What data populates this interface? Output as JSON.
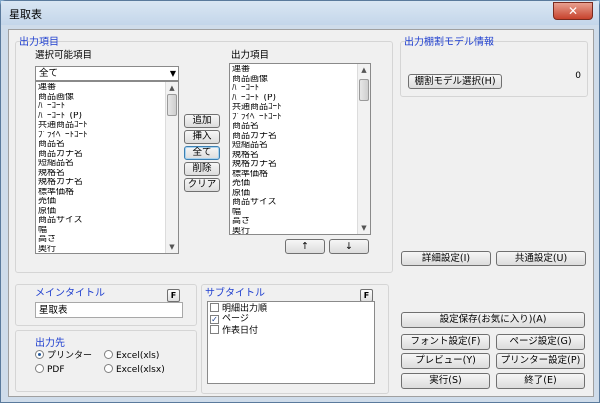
{
  "window": {
    "title": "星取表",
    "close_glyph": "✕"
  },
  "output_items_section": {
    "label": "出力項目",
    "selectable": {
      "label": "選択可能項目",
      "filter_value": "全て",
      "items": [
        "連番",
        "商品画像",
        "ﾊﾞｰｺｰﾄﾞ",
        "ﾊﾞｰｺｰﾄﾞ(P)",
        "共通商品ｺｰﾄﾞ",
        "ﾌﾟﾗｲﾍﾞｰﾄｺｰﾄﾞ",
        "商品名",
        "商品カナ名",
        "短縮品名",
        "規格名",
        "規格カナ名",
        "標準価格",
        "売価",
        "原価",
        "商品サイズ",
        "幅",
        "高さ",
        "奥行"
      ]
    },
    "output": {
      "label": "出力項目",
      "items": [
        "連番",
        "商品画像",
        "ﾊﾞｰｺｰﾄﾞ",
        "ﾊﾞｰｺｰﾄﾞ(P)",
        "共通商品ｺｰﾄﾞ",
        "ﾌﾟﾗｲﾍﾞｰﾄｺｰﾄﾞ",
        "商品名",
        "商品カナ名",
        "短縮品名",
        "規格名",
        "規格カナ名",
        "標準価格",
        "売価",
        "原価",
        "商品サイズ",
        "幅",
        "高さ",
        "奥行"
      ]
    },
    "buttons": {
      "add": "追加",
      "insert": "挿入",
      "all": "全て",
      "delete": "削除",
      "clear": "クリア"
    },
    "move_up": "↑",
    "move_down": "↓"
  },
  "shelf_model": {
    "label": "出力棚割モデル情報",
    "select_button": "棚割モデル選択(H)",
    "count_value": "0"
  },
  "main_title": {
    "label": "メインタイトル",
    "f_button": "F",
    "value": "星取表"
  },
  "sub_title": {
    "label": "サブタイトル",
    "f_button": "F",
    "items": [
      {
        "label": "明細出力順",
        "checked": false
      },
      {
        "label": "ページ",
        "checked": true
      },
      {
        "label": "作表日付",
        "checked": false
      }
    ],
    "check_glyph": "✓"
  },
  "destination": {
    "label": "出力先",
    "options": [
      {
        "label": "プリンター",
        "selected": true
      },
      {
        "label": "Excel(xls)",
        "selected": false
      },
      {
        "label": "PDF",
        "selected": false
      },
      {
        "label": "Excel(xlsx)",
        "selected": false
      }
    ]
  },
  "actions": {
    "detail_settings": "詳細設定(I)",
    "common_settings": "共通設定(U)",
    "save_settings": "設定保存(お気に入り)(A)",
    "font_settings": "フォント設定(F)",
    "page_settings": "ページ設定(G)",
    "preview": "プレビュー(Y)",
    "printer_settings": "プリンター設定(P)",
    "execute": "実行(S)",
    "exit": "終了(E)"
  },
  "colors": {
    "section_label": "#1f3fcf",
    "window_frame": "#cfdcea",
    "close_button": "#c7422c"
  },
  "icons": {
    "close": "close-icon",
    "dropdown": "chevron-down-icon",
    "scroll_up": "scroll-up-arrow-icon",
    "scroll_down": "scroll-down-arrow-icon"
  }
}
